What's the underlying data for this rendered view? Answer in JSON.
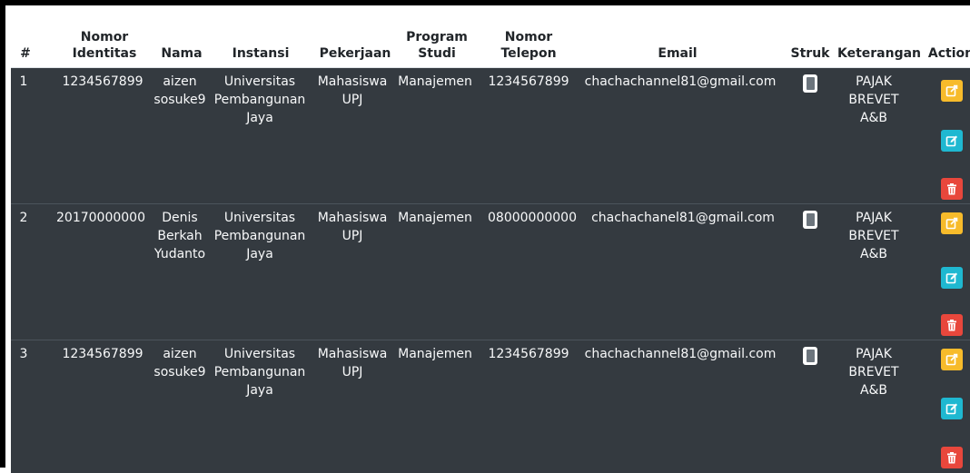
{
  "headers": {
    "no": "#",
    "identitas": [
      "Nomor",
      "Identitas"
    ],
    "nama": "Nama",
    "instansi": "Instansi",
    "pekerjaan": "Pekerjaan",
    "prodi": [
      "Program",
      "Studi"
    ],
    "telepon": [
      "Nomor",
      "Telepon"
    ],
    "email": "Email",
    "struk": "Struk",
    "keterangan": "Keterangan",
    "action": "Action"
  },
  "rows": [
    {
      "no": "1",
      "identitas": "1234567899",
      "nama": [
        "aizen",
        "sosuke9"
      ],
      "instansi": [
        "Universitas",
        "Pembangunan",
        "Jaya"
      ],
      "pekerjaan": [
        "Mahasiswa",
        "UPJ"
      ],
      "prodi": "Manajemen",
      "telepon": "1234567899",
      "email": "chachachannel81@gmail.com",
      "keterangan": [
        "PAJAK",
        "BREVET",
        "A&B"
      ]
    },
    {
      "no": "2",
      "identitas": "20170000000",
      "nama": [
        "Denis",
        "Berkah",
        "Yudanto"
      ],
      "instansi": [
        "Universitas",
        "Pembangunan",
        "Jaya"
      ],
      "pekerjaan": [
        "Mahasiswa",
        "UPJ"
      ],
      "prodi": "Manajemen",
      "telepon": "08000000000",
      "email": "chachachanel81@gmail.com",
      "keterangan": [
        "PAJAK",
        "BREVET",
        "A&B"
      ]
    },
    {
      "no": "3",
      "identitas": "1234567899",
      "nama": [
        "aizen",
        "sosuke9"
      ],
      "instansi": [
        "Universitas",
        "Pembangunan",
        "Jaya"
      ],
      "pekerjaan": [
        "Mahasiswa",
        "UPJ"
      ],
      "prodi": "Manajemen",
      "telepon": "1234567899",
      "email": "chachachannel81@gmail.com",
      "keterangan": [
        "PAJAK",
        "BREVET",
        "A&B"
      ]
    }
  ],
  "icons": {
    "struk": "receipt-icon",
    "action_1": "external-edit-icon",
    "action_2": "edit-icon",
    "action_3": "trash-icon"
  },
  "colors": {
    "table_bg": "#343a40",
    "header_bg": "#ffffff",
    "action_yellow": "#f7bb2b",
    "action_cyan": "#1fb8d1",
    "action_red": "#e8473c"
  }
}
